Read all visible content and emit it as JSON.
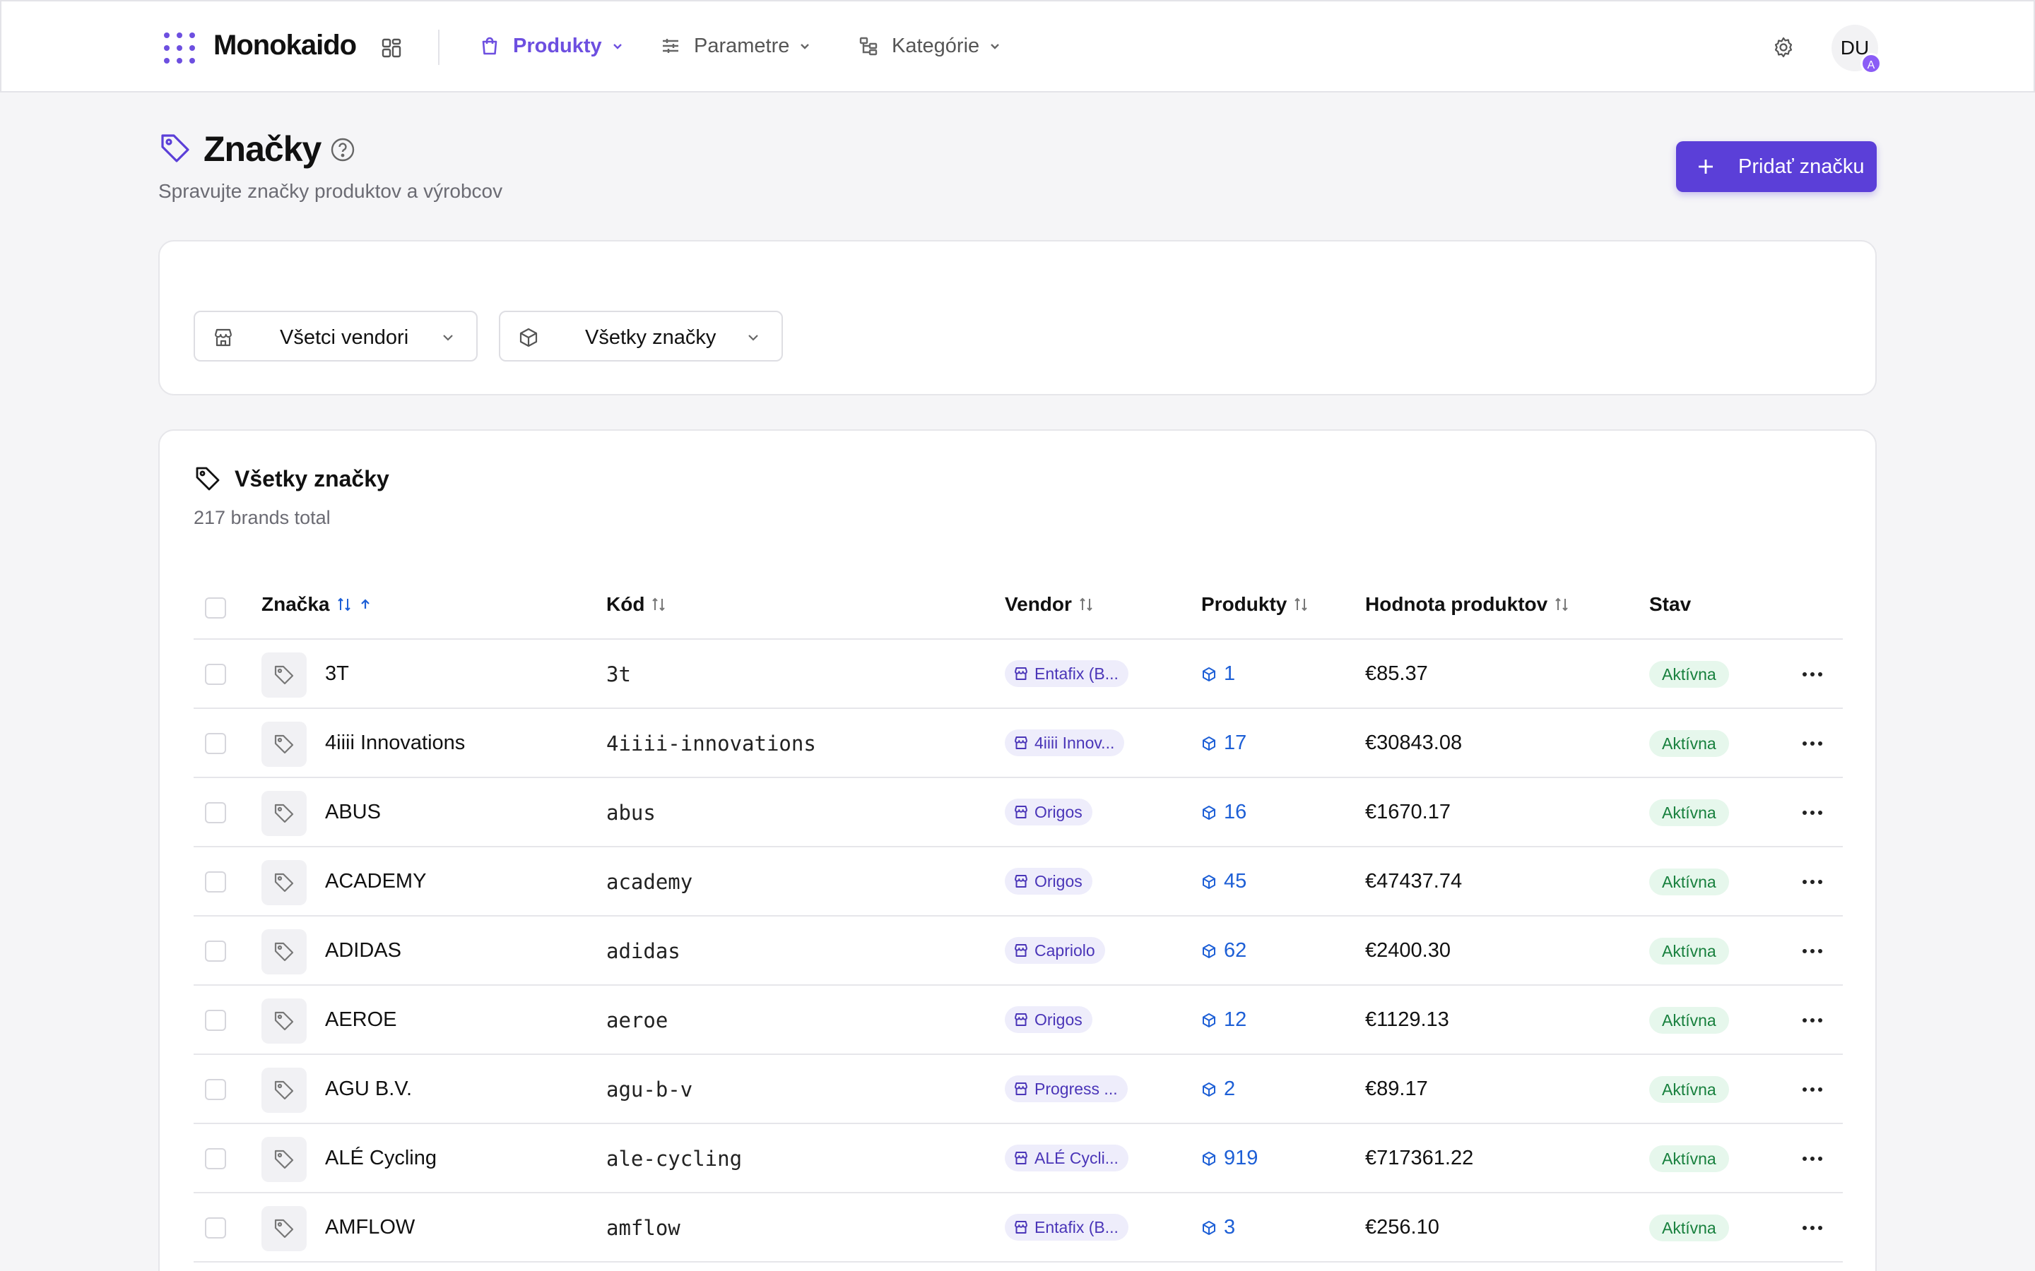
{
  "header": {
    "logo_text": "Monokaido",
    "nav": [
      {
        "label": "Produkty",
        "icon": "shopping-bag-icon",
        "active": true
      },
      {
        "label": "Parametre",
        "icon": "sliders-icon",
        "active": false
      },
      {
        "label": "Kategórie",
        "icon": "tree-icon",
        "active": false
      }
    ],
    "avatar_initials": "DU",
    "avatar_badge": "A"
  },
  "page": {
    "title": "Značky",
    "subtitle": "Spravujte značky produktov a výrobcov",
    "add_button": "Pridať značku"
  },
  "filters": {
    "vendor_select": "Všetci vendori",
    "brand_select": "Všetky značky"
  },
  "table": {
    "title": "Všetky značky",
    "subtitle": "217 brands total",
    "columns": {
      "brand": "Značka",
      "code": "Kód",
      "vendor": "Vendor",
      "products": "Produkty",
      "value": "Hodnota produktov",
      "status": "Stav"
    },
    "rows": [
      {
        "name": "3T",
        "code": "3t",
        "vendor": "Entafix (B...",
        "products": "1",
        "value": "€85.37",
        "status": "Aktívna"
      },
      {
        "name": "4iiii Innovations",
        "code": "4iiii-innovations",
        "vendor": "4iiii Innov...",
        "products": "17",
        "value": "€30843.08",
        "status": "Aktívna"
      },
      {
        "name": "ABUS",
        "code": "abus",
        "vendor": "Origos",
        "products": "16",
        "value": "€1670.17",
        "status": "Aktívna"
      },
      {
        "name": "ACADEMY",
        "code": "academy",
        "vendor": "Origos",
        "products": "45",
        "value": "€47437.74",
        "status": "Aktívna"
      },
      {
        "name": "ADIDAS",
        "code": "adidas",
        "vendor": "Capriolo",
        "products": "62",
        "value": "€2400.30",
        "status": "Aktívna"
      },
      {
        "name": "AEROE",
        "code": "aeroe",
        "vendor": "Origos",
        "products": "12",
        "value": "€1129.13",
        "status": "Aktívna"
      },
      {
        "name": "AGU B.V.",
        "code": "agu-b-v",
        "vendor": "Progress ...",
        "products": "2",
        "value": "€89.17",
        "status": "Aktívna"
      },
      {
        "name": "ALÉ Cycling",
        "code": "ale-cycling",
        "vendor": "ALÉ Cycli...",
        "products": "919",
        "value": "€717361.22",
        "status": "Aktívna"
      },
      {
        "name": "AMFLOW",
        "code": "amflow",
        "vendor": "Entafix (B...",
        "products": "3",
        "value": "€256.10",
        "status": "Aktívna"
      }
    ]
  },
  "colors": {
    "accent": "#5b3fd8",
    "link": "#1d5fd6",
    "status_bg": "#e6f7ec",
    "status_text": "#17803d"
  }
}
